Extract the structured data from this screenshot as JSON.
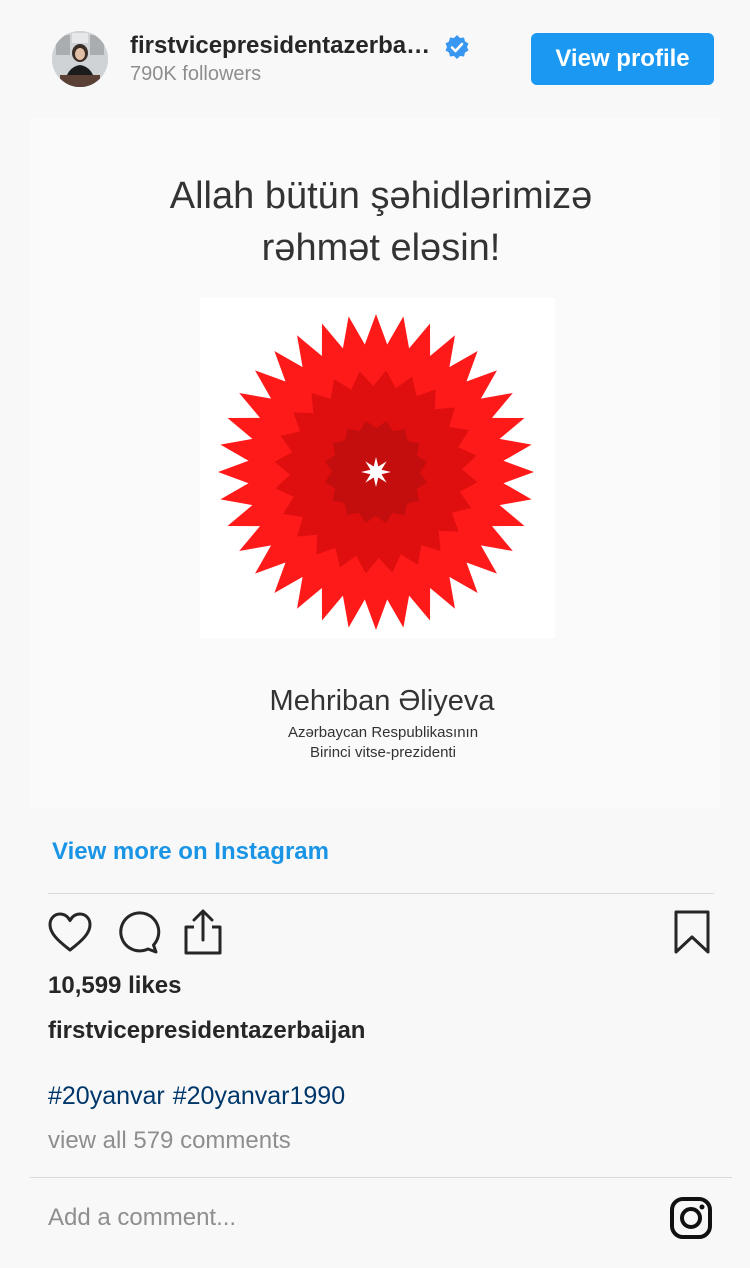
{
  "header": {
    "username": "firstvicepresidentazerba…",
    "followers": "790K followers",
    "view_profile_label": "View profile"
  },
  "post_image": {
    "line1": "Allah bütün şəhidlərimizə",
    "line2": "rəhmət eləsin!",
    "signature_name": "Mehriban Əliyeva",
    "signature_title1": "Azərbaycan Respublikasının",
    "signature_title2": "Birinci vitse-prezidenti",
    "flower_color": "#ff1a1a",
    "flower_dark": "#e00f0f",
    "flower_center": "#c40d0d"
  },
  "view_more_label": "View more on Instagram",
  "actions": {
    "like_icon": "heart-icon",
    "comment_icon": "comment-icon",
    "share_icon": "share-icon",
    "save_icon": "bookmark-icon"
  },
  "likes": "10,599 likes",
  "caption": {
    "username": "firstvicepresidentazerbaijan",
    "hashtags": [
      "#20yanvar",
      "#20yanvar1990"
    ]
  },
  "view_comments": "view all 579 comments",
  "comment_placeholder": "Add a comment...",
  "colors": {
    "accent": "#1a98f2",
    "link": "#1a95e6",
    "hashtag": "#00376b",
    "verified": "#3897f0"
  }
}
